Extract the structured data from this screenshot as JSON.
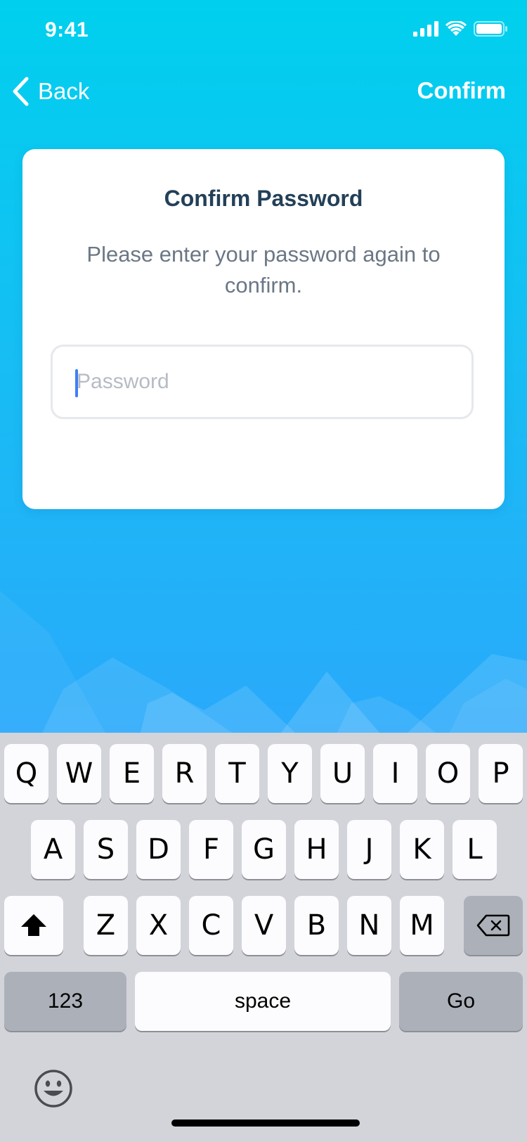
{
  "status_bar": {
    "time": "9:41"
  },
  "nav": {
    "back_label": "Back",
    "confirm_label": "Confirm"
  },
  "card": {
    "title": "Confirm Password",
    "subtitle": "Please enter your password again to confirm.",
    "password_placeholder": "Password",
    "password_value": ""
  },
  "keyboard": {
    "row1": [
      "Q",
      "W",
      "E",
      "R",
      "T",
      "Y",
      "U",
      "I",
      "O",
      "P"
    ],
    "row2": [
      "A",
      "S",
      "D",
      "F",
      "G",
      "H",
      "J",
      "K",
      "L"
    ],
    "row3": [
      "Z",
      "X",
      "C",
      "V",
      "B",
      "N",
      "M"
    ],
    "numbers_label": "123",
    "space_label": "space",
    "return_label": "Go",
    "icons": {
      "shift": "shift-icon",
      "delete": "delete-icon",
      "emoji": "emoji-icon"
    }
  },
  "colors": {
    "background_top": "#00d0ee",
    "background_bottom": "#2aa9fb",
    "title_text": "#234058",
    "caret": "#3f7ef6"
  }
}
